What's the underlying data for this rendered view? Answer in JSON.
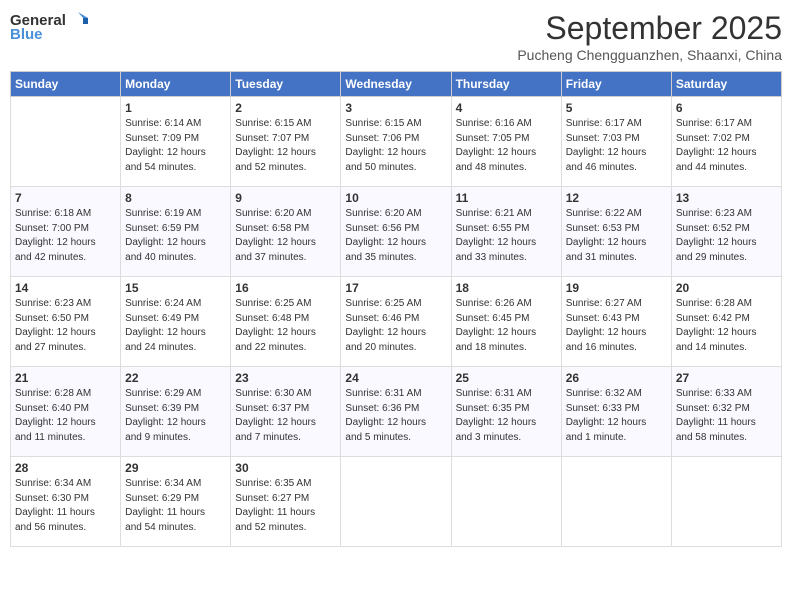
{
  "header": {
    "logo_line1": "General",
    "logo_line2": "Blue",
    "month": "September 2025",
    "location": "Pucheng Chengguanzhen, Shaanxi, China"
  },
  "days_of_week": [
    "Sunday",
    "Monday",
    "Tuesday",
    "Wednesday",
    "Thursday",
    "Friday",
    "Saturday"
  ],
  "weeks": [
    [
      {
        "day": "",
        "info": ""
      },
      {
        "day": "1",
        "info": "Sunrise: 6:14 AM\nSunset: 7:09 PM\nDaylight: 12 hours\nand 54 minutes."
      },
      {
        "day": "2",
        "info": "Sunrise: 6:15 AM\nSunset: 7:07 PM\nDaylight: 12 hours\nand 52 minutes."
      },
      {
        "day": "3",
        "info": "Sunrise: 6:15 AM\nSunset: 7:06 PM\nDaylight: 12 hours\nand 50 minutes."
      },
      {
        "day": "4",
        "info": "Sunrise: 6:16 AM\nSunset: 7:05 PM\nDaylight: 12 hours\nand 48 minutes."
      },
      {
        "day": "5",
        "info": "Sunrise: 6:17 AM\nSunset: 7:03 PM\nDaylight: 12 hours\nand 46 minutes."
      },
      {
        "day": "6",
        "info": "Sunrise: 6:17 AM\nSunset: 7:02 PM\nDaylight: 12 hours\nand 44 minutes."
      }
    ],
    [
      {
        "day": "7",
        "info": "Sunrise: 6:18 AM\nSunset: 7:00 PM\nDaylight: 12 hours\nand 42 minutes."
      },
      {
        "day": "8",
        "info": "Sunrise: 6:19 AM\nSunset: 6:59 PM\nDaylight: 12 hours\nand 40 minutes."
      },
      {
        "day": "9",
        "info": "Sunrise: 6:20 AM\nSunset: 6:58 PM\nDaylight: 12 hours\nand 37 minutes."
      },
      {
        "day": "10",
        "info": "Sunrise: 6:20 AM\nSunset: 6:56 PM\nDaylight: 12 hours\nand 35 minutes."
      },
      {
        "day": "11",
        "info": "Sunrise: 6:21 AM\nSunset: 6:55 PM\nDaylight: 12 hours\nand 33 minutes."
      },
      {
        "day": "12",
        "info": "Sunrise: 6:22 AM\nSunset: 6:53 PM\nDaylight: 12 hours\nand 31 minutes."
      },
      {
        "day": "13",
        "info": "Sunrise: 6:23 AM\nSunset: 6:52 PM\nDaylight: 12 hours\nand 29 minutes."
      }
    ],
    [
      {
        "day": "14",
        "info": "Sunrise: 6:23 AM\nSunset: 6:50 PM\nDaylight: 12 hours\nand 27 minutes."
      },
      {
        "day": "15",
        "info": "Sunrise: 6:24 AM\nSunset: 6:49 PM\nDaylight: 12 hours\nand 24 minutes."
      },
      {
        "day": "16",
        "info": "Sunrise: 6:25 AM\nSunset: 6:48 PM\nDaylight: 12 hours\nand 22 minutes."
      },
      {
        "day": "17",
        "info": "Sunrise: 6:25 AM\nSunset: 6:46 PM\nDaylight: 12 hours\nand 20 minutes."
      },
      {
        "day": "18",
        "info": "Sunrise: 6:26 AM\nSunset: 6:45 PM\nDaylight: 12 hours\nand 18 minutes."
      },
      {
        "day": "19",
        "info": "Sunrise: 6:27 AM\nSunset: 6:43 PM\nDaylight: 12 hours\nand 16 minutes."
      },
      {
        "day": "20",
        "info": "Sunrise: 6:28 AM\nSunset: 6:42 PM\nDaylight: 12 hours\nand 14 minutes."
      }
    ],
    [
      {
        "day": "21",
        "info": "Sunrise: 6:28 AM\nSunset: 6:40 PM\nDaylight: 12 hours\nand 11 minutes."
      },
      {
        "day": "22",
        "info": "Sunrise: 6:29 AM\nSunset: 6:39 PM\nDaylight: 12 hours\nand 9 minutes."
      },
      {
        "day": "23",
        "info": "Sunrise: 6:30 AM\nSunset: 6:37 PM\nDaylight: 12 hours\nand 7 minutes."
      },
      {
        "day": "24",
        "info": "Sunrise: 6:31 AM\nSunset: 6:36 PM\nDaylight: 12 hours\nand 5 minutes."
      },
      {
        "day": "25",
        "info": "Sunrise: 6:31 AM\nSunset: 6:35 PM\nDaylight: 12 hours\nand 3 minutes."
      },
      {
        "day": "26",
        "info": "Sunrise: 6:32 AM\nSunset: 6:33 PM\nDaylight: 12 hours\nand 1 minute."
      },
      {
        "day": "27",
        "info": "Sunrise: 6:33 AM\nSunset: 6:32 PM\nDaylight: 11 hours\nand 58 minutes."
      }
    ],
    [
      {
        "day": "28",
        "info": "Sunrise: 6:34 AM\nSunset: 6:30 PM\nDaylight: 11 hours\nand 56 minutes."
      },
      {
        "day": "29",
        "info": "Sunrise: 6:34 AM\nSunset: 6:29 PM\nDaylight: 11 hours\nand 54 minutes."
      },
      {
        "day": "30",
        "info": "Sunrise: 6:35 AM\nSunset: 6:27 PM\nDaylight: 11 hours\nand 52 minutes."
      },
      {
        "day": "",
        "info": ""
      },
      {
        "day": "",
        "info": ""
      },
      {
        "day": "",
        "info": ""
      },
      {
        "day": "",
        "info": ""
      }
    ]
  ]
}
